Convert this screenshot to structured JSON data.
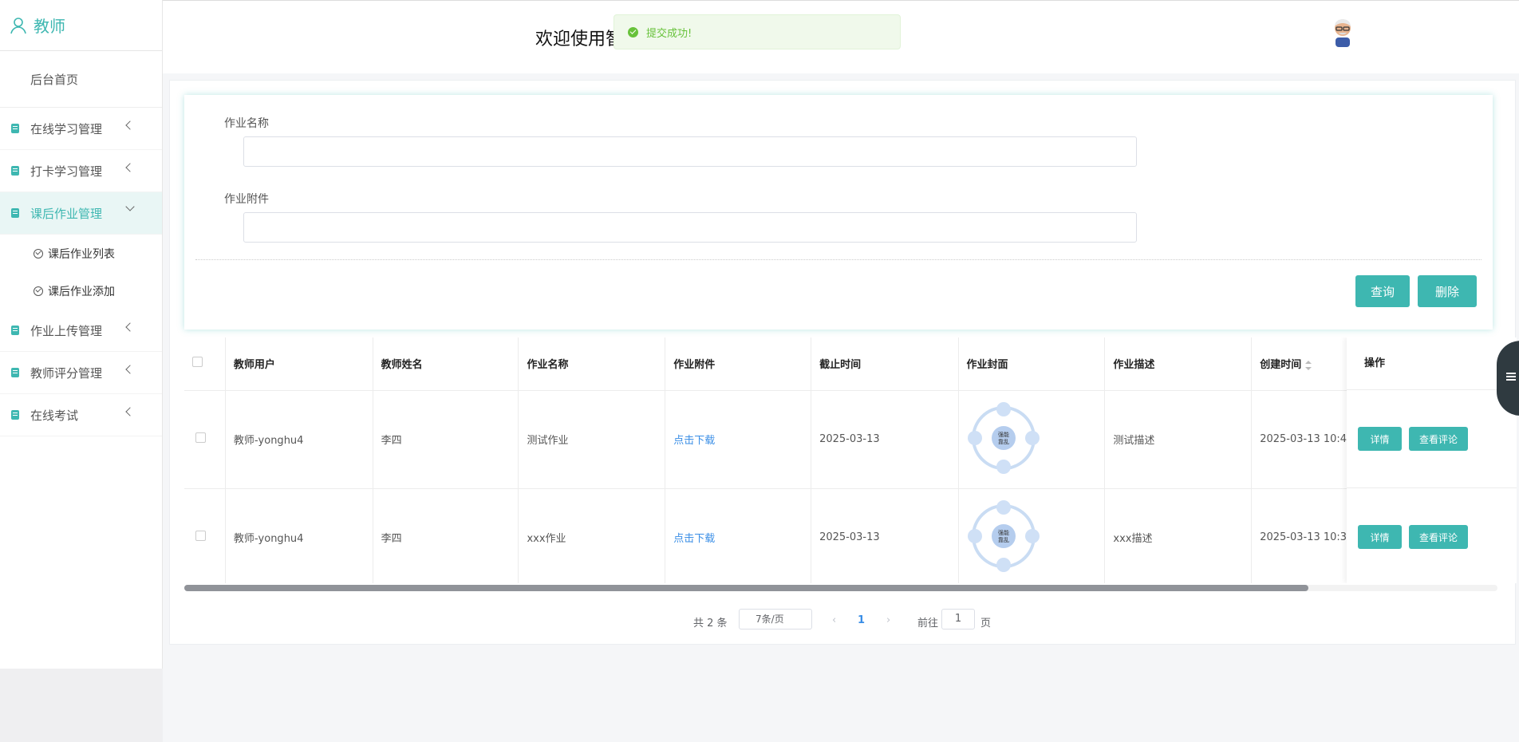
{
  "sidebar": {
    "brand": "教师",
    "home": "后台首页",
    "menus": [
      {
        "label": "在线学习管理"
      },
      {
        "label": "打卡学习管理"
      },
      {
        "label": "课后作业管理"
      },
      {
        "label": "作业上传管理"
      },
      {
        "label": "教师评分管理"
      },
      {
        "label": "在线考试"
      }
    ],
    "submenu": [
      "课后作业列表",
      "课后作业添加"
    ]
  },
  "header": {
    "welcome": "欢迎使用智",
    "toast": "提交成功!"
  },
  "search": {
    "label1": "作业名称",
    "label2": "作业附件",
    "query_button": "查询",
    "delete_button": "删除"
  },
  "table": {
    "headers": [
      "教师用户",
      "教师姓名",
      "作业名称",
      "作业附件",
      "截止时间",
      "作业封面",
      "作业描述",
      "创建时间",
      "操作"
    ],
    "rows": [
      {
        "user": "教师-yonghu4",
        "name": "李四",
        "title": "测试作业",
        "attachment": "点击下载",
        "deadline": "2025-03-13",
        "desc": "测试描述",
        "created": "2025-03-13 10:4"
      },
      {
        "user": "教师-yonghu4",
        "name": "李四",
        "title": "xxx作业",
        "attachment": "点击下载",
        "deadline": "2025-03-13",
        "desc": "xxx描述",
        "created": "2025-03-13 10:3"
      }
    ],
    "ops": {
      "detail": "详情",
      "comment": "查看评论"
    },
    "cover_text": "强能\n靠乱"
  },
  "pagination": {
    "total": "共 2 条",
    "page_size": "7条/页",
    "prev": "‹",
    "current": "1",
    "next": "›",
    "goto_prefix": "前往",
    "goto_value": "1",
    "goto_suffix": "页"
  },
  "colors": {
    "accent": "#3eb7b1",
    "link": "#3a8ee6",
    "success": "#67c23a"
  }
}
